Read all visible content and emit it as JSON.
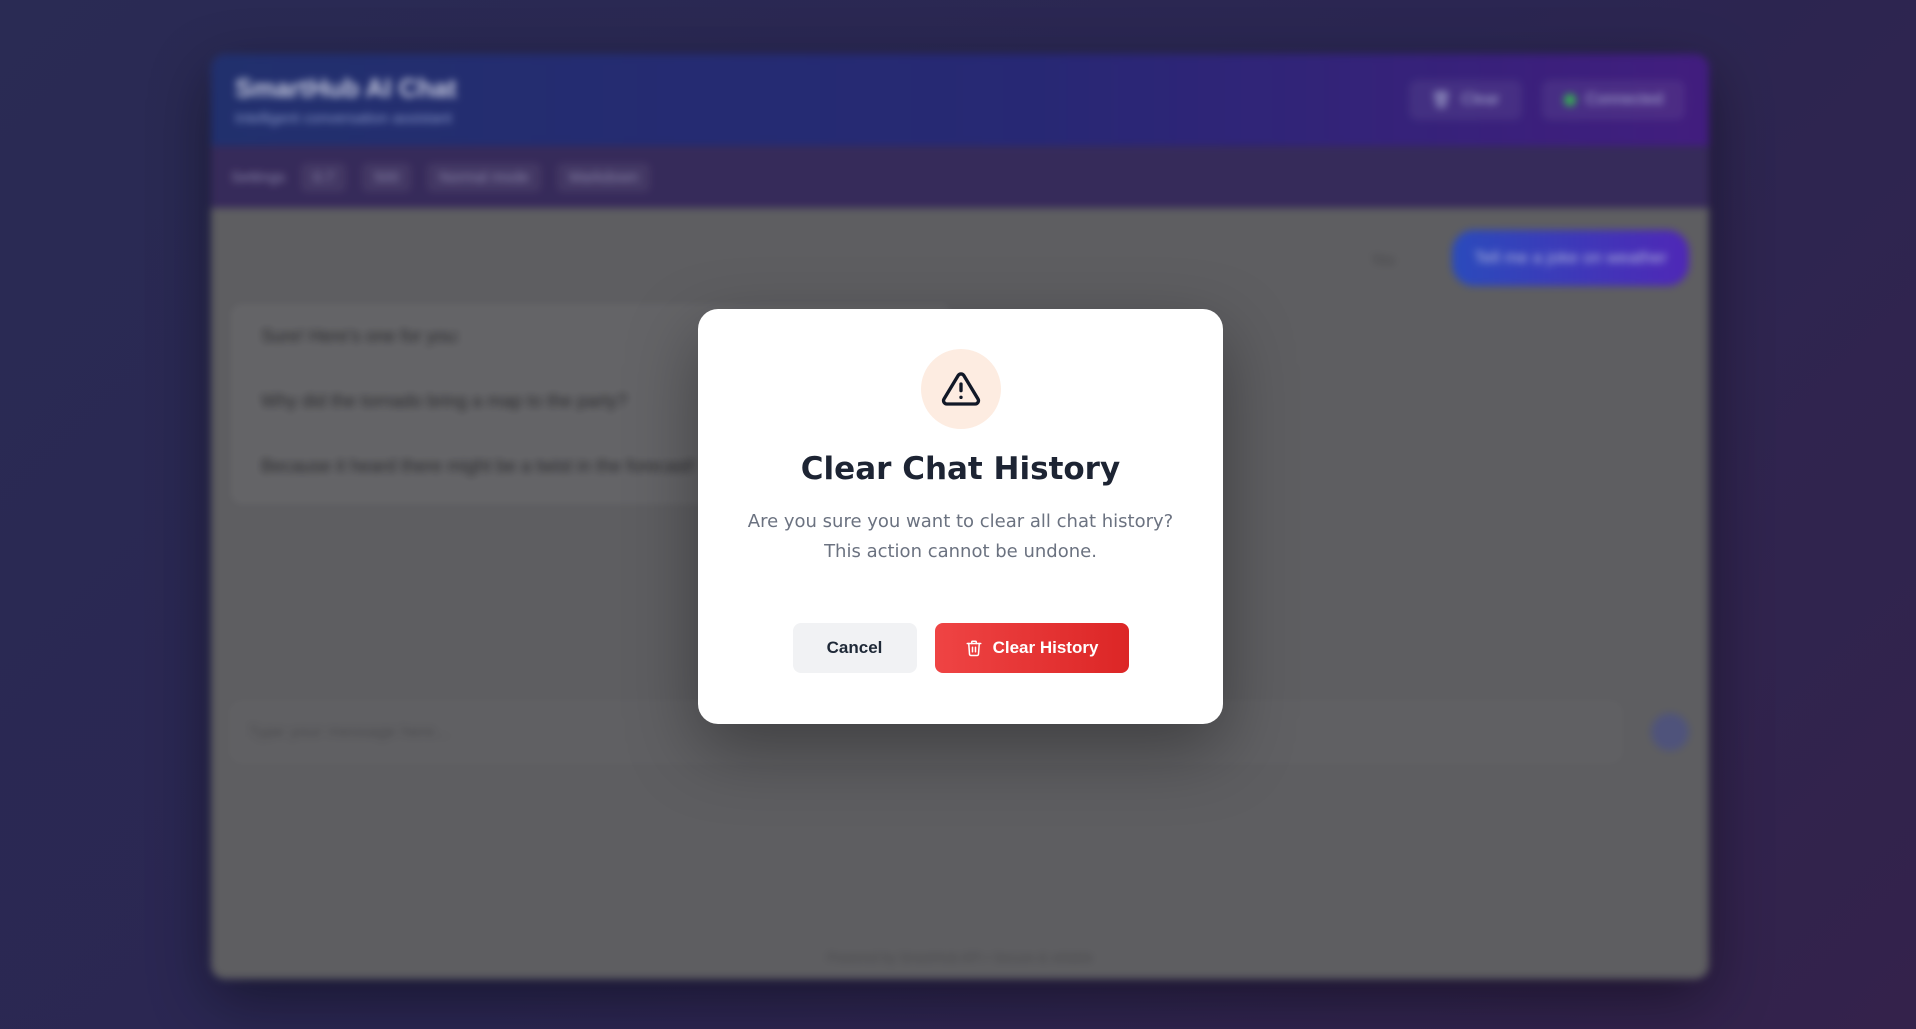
{
  "app": {
    "title": "SmartHub AI Chat",
    "subtitle": "Intelligent conversation assistant",
    "header_buttons": {
      "clear_label": "Clear",
      "status_label": "Connected"
    },
    "toolbar": {
      "settings_label": "Settings",
      "chip_1": "0.7",
      "chip_2": "500",
      "chip_3": "Normal mode",
      "chip_4": "Markdown"
    },
    "messages": {
      "user_tag": "You",
      "user_message": "Tell me a joke on weather",
      "bot_lines": [
        "Sure! Here's one for you:",
        "Why did the tornado bring a map to the party?",
        "Because it heard there might be a twist in the forecast!"
      ]
    },
    "input": {
      "placeholder": "Type your message here..."
    },
    "footer": "Powered by SmartHub API • Secure & reliable"
  },
  "modal": {
    "icon": "warning-triangle-icon",
    "title": "Clear Chat History",
    "message": "Are you sure you want to clear all chat history? This action cannot be undone.",
    "cancel_label": "Cancel",
    "confirm_label": "Clear History",
    "confirm_icon": "trash-icon"
  },
  "colors": {
    "danger": "#ef4444",
    "warning_bg": "#fdece1",
    "header_start": "#24357a",
    "header_end": "#4a1f8e"
  }
}
